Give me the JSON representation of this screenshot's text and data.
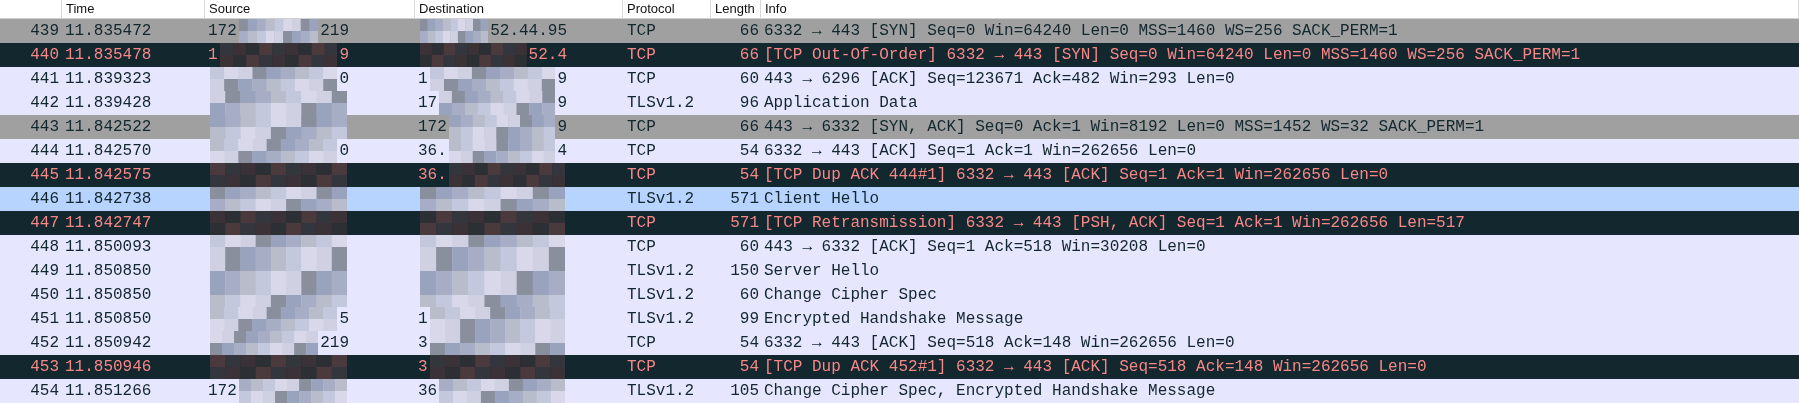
{
  "columns": [
    {},
    {
      "label": "Time"
    },
    {
      "label": "Source"
    },
    {
      "label": "Destination"
    },
    {
      "label": "Protocol"
    },
    {
      "label": "Length"
    },
    {
      "label": "Info"
    }
  ],
  "packets": [
    {
      "no": "439",
      "time": "11.835472",
      "src_head": "172",
      "src_tail": "219",
      "dst_tail": "52.44.95",
      "protocol": "TCP",
      "length": "66",
      "info": "6332 → 443 [SYN] Seq=0 Win=64240 Len=0 MSS=1460 WS=256 SACK_PERM=1",
      "kind": "syn",
      "selected": false
    },
    {
      "no": "440",
      "time": "11.835478",
      "src_head": "1",
      "src_tail": "9",
      "dst_tail": "52.4",
      "protocol": "TCP",
      "length": "66",
      "info": "[TCP Out-Of-Order] 6332 → 443 [SYN] Seq=0 Win=64240 Len=0 MSS=1460 WS=256 SACK_PERM=1",
      "kind": "bad",
      "selected": false
    },
    {
      "no": "441",
      "time": "11.839323",
      "src_tail": "0",
      "dst_head": "1",
      "dst_tail": "9",
      "protocol": "TCP",
      "length": "60",
      "info": "443 → 6296 [ACK] Seq=123671 Ack=482 Win=293 Len=0",
      "kind": "normal",
      "selected": false
    },
    {
      "no": "442",
      "time": "11.839428",
      "dst_head": "17",
      "dst_tail": "9",
      "protocol": "TLSv1.2",
      "length": "96",
      "info": "Application Data",
      "kind": "normal",
      "selected": false
    },
    {
      "no": "443",
      "time": "11.842522",
      "dst_head": "172",
      "dst_tail": "9",
      "protocol": "TCP",
      "length": "66",
      "info": "443 → 6332 [SYN, ACK] Seq=0 Ack=1 Win=8192 Len=0 MSS=1452 WS=32 SACK_PERM=1",
      "kind": "syn",
      "selected": false
    },
    {
      "no": "444",
      "time": "11.842570",
      "src_tail": "0",
      "dst_head": "36.",
      "dst_tail": "4",
      "protocol": "TCP",
      "length": "54",
      "info": "6332 → 443 [ACK] Seq=1 Ack=1 Win=262656 Len=0",
      "kind": "normal",
      "selected": false
    },
    {
      "no": "445",
      "time": "11.842575",
      "dst_head": "36.",
      "protocol": "TCP",
      "length": "54",
      "info": "[TCP Dup ACK 444#1] 6332 → 443 [ACK] Seq=1 Ack=1 Win=262656 Len=0",
      "kind": "bad",
      "selected": false
    },
    {
      "no": "446",
      "time": "11.842738",
      "protocol": "TLSv1.2",
      "length": "571",
      "info": "Client Hello",
      "kind": "normal",
      "selected": true
    },
    {
      "no": "447",
      "time": "11.842747",
      "protocol": "TCP",
      "length": "571",
      "info": "[TCP Retransmission] 6332 → 443 [PSH, ACK] Seq=1 Ack=1 Win=262656 Len=517",
      "kind": "bad",
      "selected": false
    },
    {
      "no": "448",
      "time": "11.850093",
      "protocol": "TCP",
      "length": "60",
      "info": "443 → 6332 [ACK] Seq=1 Ack=518 Win=30208 Len=0",
      "kind": "normal",
      "selected": false
    },
    {
      "no": "449",
      "time": "11.850850",
      "protocol": "TLSv1.2",
      "length": "150",
      "info": "Server Hello",
      "kind": "normal",
      "selected": false
    },
    {
      "no": "450",
      "time": "11.850850",
      "protocol": "TLSv1.2",
      "length": "60",
      "info": "Change Cipher Spec",
      "kind": "normal",
      "selected": false
    },
    {
      "no": "451",
      "time": "11.850850",
      "src_tail": "5",
      "dst_head": "1",
      "protocol": "TLSv1.2",
      "length": "99",
      "info": "Encrypted Handshake Message",
      "kind": "normal",
      "selected": false
    },
    {
      "no": "452",
      "time": "11.850942",
      "src_tail": "219",
      "dst_head": "3",
      "protocol": "TCP",
      "length": "54",
      "info": "6332 → 443 [ACK] Seq=518 Ack=148 Win=262656 Len=0",
      "kind": "normal",
      "selected": false
    },
    {
      "no": "453",
      "time": "11.850946",
      "dst_head": "3",
      "protocol": "TCP",
      "length": "54",
      "info": "[TCP Dup ACK 452#1] 6332 → 443 [ACK] Seq=518 Ack=148 Win=262656 Len=0",
      "kind": "bad",
      "selected": false
    },
    {
      "no": "454",
      "time": "11.851266",
      "src_head": "172",
      "dst_head": "36",
      "protocol": "TLSv1.2",
      "length": "105",
      "info": "Change Cipher Spec, Encrypted Handshake Message",
      "kind": "normal",
      "selected": false
    }
  ]
}
